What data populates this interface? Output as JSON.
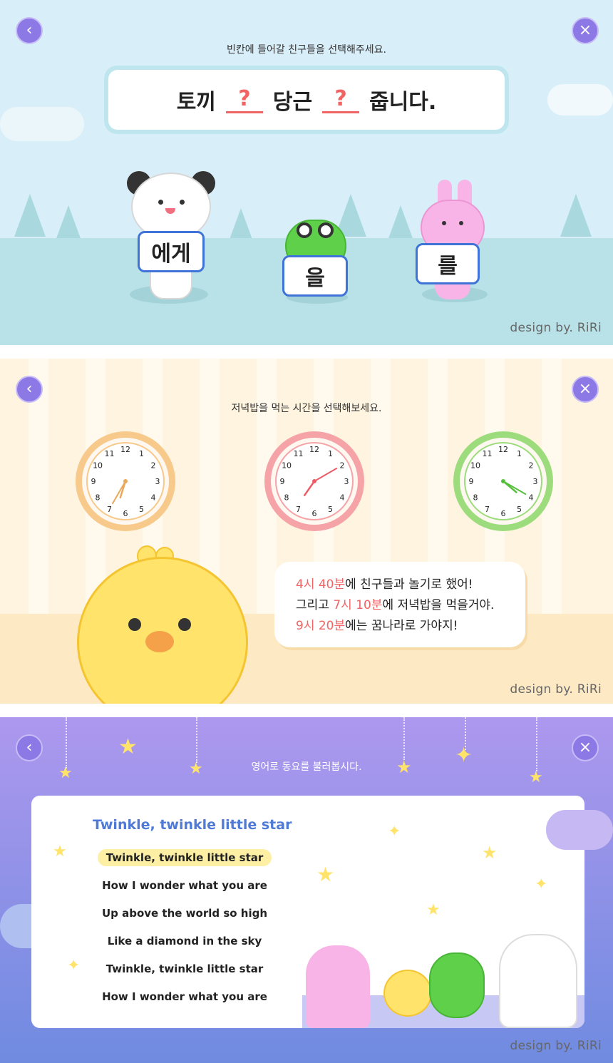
{
  "nav": {
    "back_icon": "‹",
    "close_icon": "×"
  },
  "credit": "design by. RiRi",
  "panel1": {
    "instruction": "빈칸에 들어갈 친구들을 선택해주세요.",
    "sentence": {
      "part1": "토끼",
      "blank": "?",
      "part2": "당근",
      "part3": "줍니다."
    },
    "options": [
      {
        "character": "panda",
        "label": "에게"
      },
      {
        "character": "frog",
        "label": "을"
      },
      {
        "character": "rabbit",
        "label": "를"
      }
    ]
  },
  "panel2": {
    "instruction": "저녁밥을 먹는 시간을 선택해보세요.",
    "clocks": [
      {
        "color": "#f7c98a",
        "hand_color": "#e9a95c",
        "hour": 6,
        "minute": 35
      },
      {
        "color": "#f6a3a8",
        "hand_color": "#ee5b66",
        "hour": 7,
        "minute": 10
      },
      {
        "color": "#9ddc7c",
        "hand_color": "#58bf3d",
        "hour": 4,
        "minute": 20
      }
    ],
    "clock_numbers": [
      "12",
      "1",
      "2",
      "3",
      "4",
      "5",
      "6",
      "7",
      "8",
      "9",
      "10",
      "11"
    ],
    "speech": [
      {
        "time": "4시 40분",
        "rest": "에 친구들과 놀기로 했어!"
      },
      {
        "prefix": "그리고 ",
        "time": "7시 10분",
        "rest": "에 저녁밥을 먹을거야."
      },
      {
        "time": "9시 20분",
        "rest": "에는 꿈나라로 가야지!"
      }
    ]
  },
  "panel3": {
    "instruction": "영어로 동요를 불러봅시다.",
    "song_title": "Twinkle, twinkle little star",
    "lyrics": [
      "Twinkle, twinkle little star",
      "How I wonder what you are",
      "Up above the world so high",
      "Like  a diamond in the sky",
      "Twinkle, twinkle little star",
      "How I wonder what you are"
    ],
    "highlighted_line": 0
  },
  "colors": {
    "accent": "#8d79e6",
    "question_mark": "#f06464",
    "song_title": "#4f7ad6",
    "highlight": "#fdf0a4"
  }
}
